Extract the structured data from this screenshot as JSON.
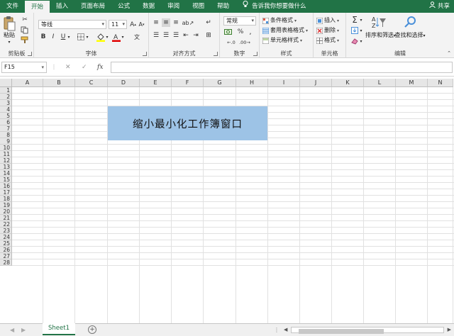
{
  "tabs": [
    "文件",
    "开始",
    "插入",
    "页面布局",
    "公式",
    "数据",
    "审阅",
    "视图",
    "帮助"
  ],
  "active_tab": "开始",
  "tell_me": "告诉我你想要做什么",
  "share": "共享",
  "groups": {
    "clipboard": {
      "label": "剪贴板",
      "paste": "粘贴"
    },
    "font": {
      "label": "字体",
      "font_name": "等线",
      "font_size": "11",
      "bold": "B",
      "italic": "I",
      "underline": "U"
    },
    "alignment": {
      "label": "对齐方式"
    },
    "number": {
      "label": "数字",
      "format": "常规"
    },
    "styles": {
      "label": "样式",
      "items": [
        "条件格式",
        "套用表格格式",
        "单元格样式"
      ]
    },
    "cells": {
      "label": "单元格",
      "items": [
        "插入",
        "删除",
        "格式"
      ]
    },
    "editing": {
      "label": "编辑",
      "sort_filter": "排序和筛选",
      "find_select": "查找和选择"
    }
  },
  "formula_bar": {
    "name_box": "F15",
    "fx": "fx",
    "value": ""
  },
  "columns": [
    "A",
    "B",
    "C",
    "D",
    "E",
    "F",
    "G",
    "H",
    "I",
    "J",
    "K",
    "L",
    "M",
    "N"
  ],
  "rows": [
    "1",
    "2",
    "3",
    "4",
    "5",
    "6",
    "7",
    "8",
    "9",
    "10",
    "11",
    "12",
    "13",
    "14",
    "15",
    "16",
    "17",
    "18",
    "19",
    "20",
    "21",
    "22",
    "23",
    "24",
    "25",
    "26",
    "27",
    "28"
  ],
  "banner_text": "缩小最小化工作簿窗口",
  "colors": {
    "accent": "#217346",
    "banner_fill": "#9dc3e6"
  },
  "sheet_tab": "Sheet1"
}
